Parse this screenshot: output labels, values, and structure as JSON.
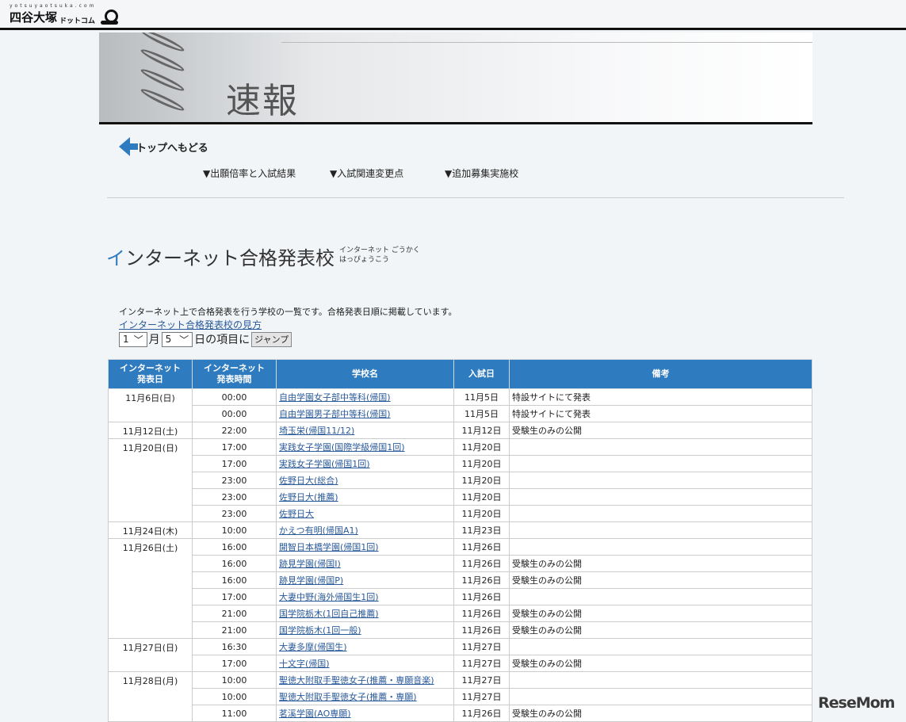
{
  "header": {
    "logo_small": "yotsuyaotsuka.com",
    "logo_main": "四谷大塚",
    "logo_sub": "ドットコム"
  },
  "banner": {
    "title": "速報"
  },
  "nav": {
    "back": "トップへもどる",
    "anchors": [
      "▼出願倍率と入試結果",
      "▼入試関連変更点",
      "▼追加募集実施校"
    ]
  },
  "section": {
    "title_first": "イ",
    "title_rest": "ンターネット合格発表校",
    "ruby1": "インターネット ごうかく",
    "ruby2": "はっぴょうこう",
    "intro": "インターネット上で合格発表を行う学校の一覧です。合格発表日順に掲載しています。",
    "guide_link": "インターネット合格発表校の見方"
  },
  "jump": {
    "month": "1",
    "month_label": "月",
    "day": "5",
    "day_label": "日の項目に",
    "button": "ジャンプ"
  },
  "table": {
    "headers": [
      "インターネット\n発表日",
      "インターネット\n発表時間",
      "学校名",
      "入試日",
      "備考"
    ],
    "groups": [
      {
        "date": "11月6日(日)",
        "rows": [
          [
            "00:00",
            "自由学園女子部中等科(帰国)",
            "11月5日",
            "特設サイトにて発表"
          ],
          [
            "00:00",
            "自由学園男子部中等科(帰国)",
            "11月5日",
            "特設サイトにて発表"
          ]
        ]
      },
      {
        "date": "11月12日(土)",
        "rows": [
          [
            "22:00",
            "埼玉栄(帰国11/12)",
            "11月12日",
            "受験生のみの公開"
          ]
        ]
      },
      {
        "date": "11月20日(日)",
        "rows": [
          [
            "17:00",
            "実践女子学園(国際学級帰国1回)",
            "11月20日",
            ""
          ],
          [
            "17:00",
            "実践女子学園(帰国1回)",
            "11月20日",
            ""
          ],
          [
            "23:00",
            "佐野日大(総合)",
            "11月20日",
            ""
          ],
          [
            "23:00",
            "佐野日大(推薦)",
            "11月20日",
            ""
          ],
          [
            "23:00",
            "佐野日大",
            "11月20日",
            ""
          ]
        ]
      },
      {
        "date": "11月24日(木)",
        "rows": [
          [
            "10:00",
            "かえつ有明(帰国A1)",
            "11月23日",
            ""
          ]
        ]
      },
      {
        "date": "11月26日(土)",
        "rows": [
          [
            "16:00",
            "開智日本橋学園(帰国1回)",
            "11月26日",
            ""
          ],
          [
            "16:00",
            "跡見学園(帰国I)",
            "11月26日",
            "受験生のみの公開"
          ],
          [
            "16:00",
            "跡見学園(帰国P)",
            "11月26日",
            "受験生のみの公開"
          ],
          [
            "17:00",
            "大妻中野(海外帰国生1回)",
            "11月26日",
            ""
          ],
          [
            "21:00",
            "国学院栃木(1回自己推薦)",
            "11月26日",
            "受験生のみの公開"
          ],
          [
            "21:00",
            "国学院栃木(1回一般)",
            "11月26日",
            "受験生のみの公開"
          ]
        ]
      },
      {
        "date": "11月27日(日)",
        "rows": [
          [
            "16:30",
            "大妻多摩(帰国生)",
            "11月27日",
            ""
          ],
          [
            "17:00",
            "十文字(帰国)",
            "11月27日",
            "受験生のみの公開"
          ]
        ]
      },
      {
        "date": "11月28日(月)",
        "rows": [
          [
            "10:00",
            "聖徳大附取手聖徳女子(推薦・専願音楽)",
            "11月27日",
            ""
          ],
          [
            "10:00",
            "聖徳大附取手聖徳女子(推薦・専願)",
            "11月27日",
            ""
          ],
          [
            "11:00",
            "茗溪学園(AO専願)",
            "11月26日",
            "受験生のみの公開"
          ]
        ]
      }
    ]
  },
  "watermark": "ReseMom"
}
